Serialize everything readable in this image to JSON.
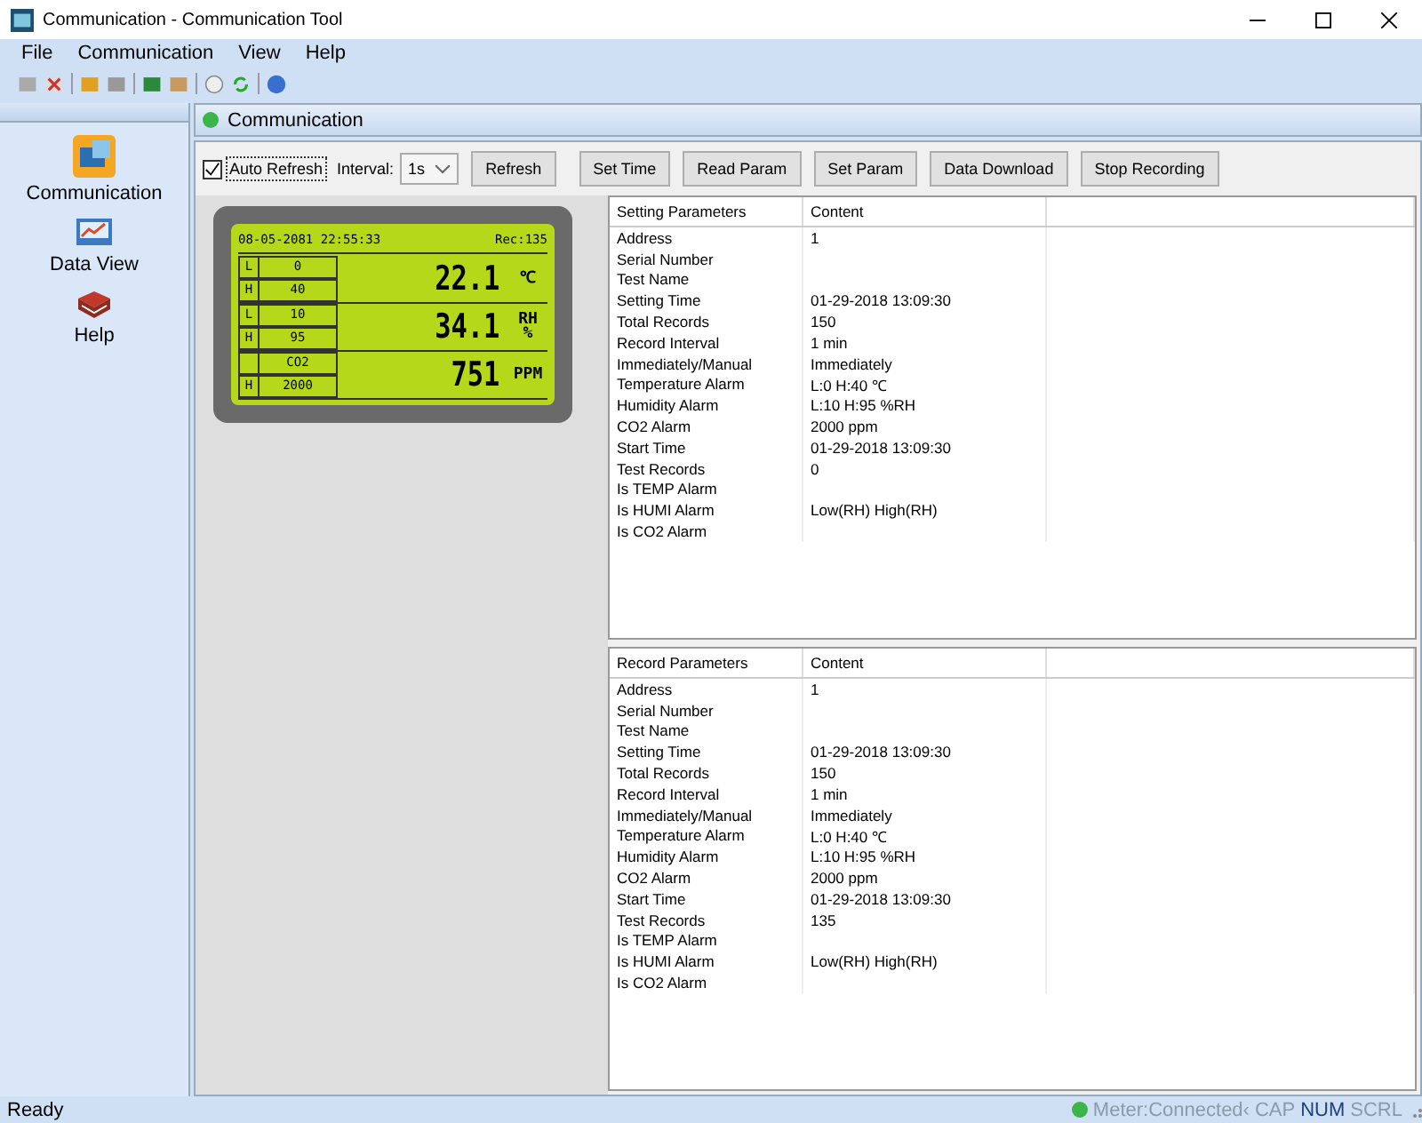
{
  "window": {
    "title": "Communication - Communication Tool"
  },
  "menu": [
    "File",
    "Communication",
    "View",
    "Help"
  ],
  "sidebar": {
    "items": [
      {
        "label": "Communication"
      },
      {
        "label": "Data View"
      },
      {
        "label": "Help"
      }
    ]
  },
  "panel": {
    "title": "Communication",
    "connected": true
  },
  "controls": {
    "auto_refresh": {
      "label": "Auto Refresh",
      "checked": true
    },
    "interval_label": "Interval:",
    "interval": "1s",
    "buttons": [
      "Refresh",
      "Set Time",
      "Read Param",
      "Set Param",
      "Data Download",
      "Stop Recording"
    ]
  },
  "lcd": {
    "datetime": "08-05-2081 22:55:33",
    "record": "Rec:135",
    "rows": [
      {
        "cells": [
          {
            "label": "L",
            "value": "0"
          },
          {
            "label": "H",
            "value": "40"
          }
        ],
        "reading": "22.1",
        "unit": [
          "℃"
        ]
      },
      {
        "cells": [
          {
            "label": "L",
            "value": "10"
          },
          {
            "label": "H",
            "value": "95"
          }
        ],
        "reading": "34.1",
        "unit": [
          "RH",
          "%"
        ]
      },
      {
        "cells": [
          {
            "value": "CO2"
          },
          {
            "label": "H",
            "value": "2000"
          }
        ],
        "reading": "751",
        "unit": [
          "PPM"
        ]
      }
    ]
  },
  "tables": [
    {
      "columns": [
        "Setting Parameters",
        "Content"
      ],
      "rows": [
        [
          "Address",
          "1"
        ],
        [
          "Serial Number",
          ""
        ],
        [
          "Test Name",
          ""
        ],
        [
          "Setting Time",
          "01-29-2018 13:09:30"
        ],
        [
          "Total Records",
          "150"
        ],
        [
          "Record Interval",
          "1 min"
        ],
        [
          "Immediately/Manual",
          "Immediately"
        ],
        [
          "Temperature Alarm",
          "L:0 H:40 ℃"
        ],
        [
          "Humidity Alarm",
          "L:10 H:95 %RH"
        ],
        [
          "CO2 Alarm",
          "2000 ppm"
        ],
        [
          "Start Time",
          "01-29-2018 13:09:30"
        ],
        [
          "Test Records",
          "0"
        ],
        [
          "Is TEMP Alarm",
          ""
        ],
        [
          "Is HUMI Alarm",
          "Low(RH) High(RH)"
        ],
        [
          "Is CO2 Alarm",
          ""
        ]
      ]
    },
    {
      "columns": [
        "Record Parameters",
        "Content"
      ],
      "rows": [
        [
          "Address",
          "1"
        ],
        [
          "Serial Number",
          ""
        ],
        [
          "Test Name",
          ""
        ],
        [
          "Setting Time",
          "01-29-2018 13:09:30"
        ],
        [
          "Total Records",
          "150"
        ],
        [
          "Record Interval",
          "1 min"
        ],
        [
          "Immediately/Manual",
          "Immediately"
        ],
        [
          "Temperature Alarm",
          "L:0 H:40 ℃"
        ],
        [
          "Humidity Alarm",
          "L:10 H:95 %RH"
        ],
        [
          "CO2 Alarm",
          "2000 ppm"
        ],
        [
          "Start Time",
          "01-29-2018 13:09:30"
        ],
        [
          "Test Records",
          "135"
        ],
        [
          "Is TEMP Alarm",
          ""
        ],
        [
          "Is HUMI Alarm",
          "Low(RH) High(RH)"
        ],
        [
          "Is CO2 Alarm",
          ""
        ]
      ]
    }
  ],
  "status_bar": {
    "text": "Ready",
    "meter": {
      "text": "Meter:Connected‹",
      "connected": true
    },
    "keys": [
      {
        "label": "CAP",
        "on": false
      },
      {
        "label": "NUM",
        "on": true
      },
      {
        "label": "SCRL",
        "on": false
      }
    ]
  }
}
